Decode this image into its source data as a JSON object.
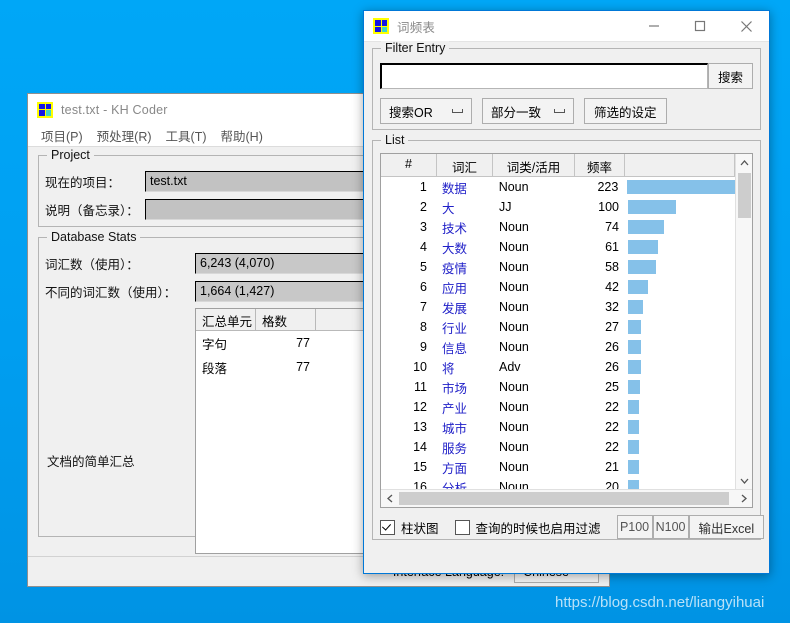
{
  "desktop": {
    "background": "#00a2f3"
  },
  "main_window": {
    "title": "test.txt - KH Coder",
    "icon": "khcoder-grid-icon",
    "menu": [
      {
        "label": "项目(P)"
      },
      {
        "label": "预处理(R)"
      },
      {
        "label": "工具(T)"
      },
      {
        "label": "帮助(H)"
      }
    ],
    "project_group": {
      "legend": "Project",
      "fields": [
        {
          "label": "现在的项目：",
          "value": "test.txt"
        },
        {
          "label": "说明（备忘录）：",
          "value": ""
        }
      ]
    },
    "database_group": {
      "legend": "Database Stats",
      "fields": [
        {
          "label": "词汇数（使用）：",
          "value": "6,243 (4,070)"
        },
        {
          "label": "不同的词汇数（使用）：",
          "value": "1,664 (1,427)"
        }
      ],
      "note": "文档的简单汇总",
      "table": {
        "headers": [
          "汇总单元",
          "格数",
          ""
        ],
        "rows": [
          {
            "unit": "字句",
            "count": "77"
          },
          {
            "unit": "段落",
            "count": "77"
          }
        ]
      }
    },
    "status_bar": {
      "language_label": "Interface Language:",
      "language_value": "Chinese"
    }
  },
  "freq_window": {
    "title": "词频表",
    "icon": "khcoder-grid-icon",
    "controls": {
      "minimize": "minimize-icon",
      "maximize": "maximize-icon",
      "close": "close-icon"
    },
    "filter_group": {
      "legend": "Filter Entry",
      "search_value": "",
      "search_placeholder": "",
      "search_button": "搜索",
      "mode_dropdown": "搜索OR",
      "match_dropdown": "部分一致",
      "settings_button": "筛选的设定"
    },
    "list_group": {
      "legend": "List",
      "headers": [
        "#",
        "词汇",
        "词类/活用",
        "频率",
        ""
      ],
      "rows": [
        {
          "num": "1",
          "word": "数据",
          "pos": "Noun",
          "freq": "223"
        },
        {
          "num": "2",
          "word": "大",
          "pos": "JJ",
          "freq": "100"
        },
        {
          "num": "3",
          "word": "技术",
          "pos": "Noun",
          "freq": "74"
        },
        {
          "num": "4",
          "word": "大数",
          "pos": "Noun",
          "freq": "61"
        },
        {
          "num": "5",
          "word": "疫情",
          "pos": "Noun",
          "freq": "58"
        },
        {
          "num": "6",
          "word": "应用",
          "pos": "Noun",
          "freq": "42"
        },
        {
          "num": "7",
          "word": "发展",
          "pos": "Noun",
          "freq": "32"
        },
        {
          "num": "8",
          "word": "行业",
          "pos": "Noun",
          "freq": "27"
        },
        {
          "num": "9",
          "word": "信息",
          "pos": "Noun",
          "freq": "26"
        },
        {
          "num": "10",
          "word": "将",
          "pos": "Adv",
          "freq": "26"
        },
        {
          "num": "11",
          "word": "市场",
          "pos": "Noun",
          "freq": "25"
        },
        {
          "num": "12",
          "word": "产业",
          "pos": "Noun",
          "freq": "22"
        },
        {
          "num": "13",
          "word": "城市",
          "pos": "Noun",
          "freq": "22"
        },
        {
          "num": "14",
          "word": "服务",
          "pos": "Noun",
          "freq": "22"
        },
        {
          "num": "15",
          "word": "方面",
          "pos": "Noun",
          "freq": "21"
        },
        {
          "num": "16",
          "word": "分析",
          "pos": "Noun",
          "freq": "20"
        }
      ]
    },
    "bottom_bar": {
      "bar_chart_label": "柱状图",
      "bar_chart_checked": true,
      "filter_on_query_label": "查询的时候也启用过滤",
      "filter_on_query_checked": false,
      "p100_button": "P100",
      "n100_button": "N100",
      "export_button": "输出Excel"
    }
  },
  "watermark": "https://blog.csdn.net/liangyihuai",
  "chart_data": {
    "type": "bar",
    "title": "词频表",
    "categories": [
      "数据",
      "大",
      "技术",
      "大数",
      "疫情",
      "应用",
      "发展",
      "行业",
      "信息",
      "将",
      "市场",
      "产业",
      "城市",
      "服务",
      "方面",
      "分析"
    ],
    "values": [
      223,
      100,
      74,
      61,
      58,
      42,
      32,
      27,
      26,
      26,
      25,
      22,
      22,
      22,
      21,
      20
    ],
    "xlabel": "频率",
    "ylabel": "词汇",
    "xlim": [
      0,
      223
    ],
    "bar_color": "#85c1e9",
    "grid": false,
    "legend": false
  }
}
